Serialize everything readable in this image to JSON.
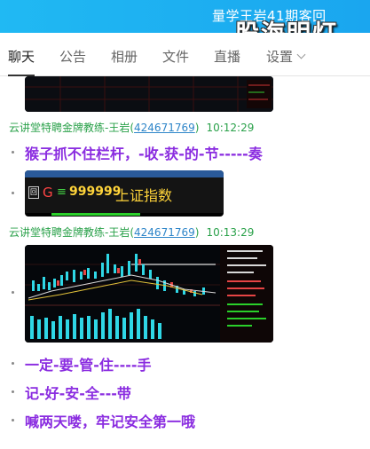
{
  "window": {
    "title": "量学王岩41期客回",
    "watermark": "股海明灯"
  },
  "tabs": [
    {
      "label": "聊天",
      "active": true
    },
    {
      "label": "公告"
    },
    {
      "label": "相册"
    },
    {
      "label": "文件"
    },
    {
      "label": "直播"
    },
    {
      "label": "设置"
    }
  ],
  "messages": {
    "m1": {
      "sender": "云讲堂特聘金牌教练-王岩",
      "qq": "424671769",
      "time": "10:12:29"
    },
    "m1_text": "猴子抓不住栏杆，-收-获-的-节-----奏",
    "quote": {
      "g": "G",
      "eq": "≡",
      "code": "999999",
      "name": "上证指数"
    },
    "m2": {
      "sender": "云讲堂特聘金牌教练-王岩",
      "qq": "424671769",
      "time": "10:13:29"
    },
    "lines": [
      "一定-要-管-住----手",
      "记-好-安-全---带",
      "喊两天喽，牢记安全第一哦"
    ]
  },
  "colors": {
    "titlebar": "#1aa6ef",
    "sender_green": "#2aa14a",
    "link_blue": "#2f86c9",
    "message_purple": "#8a2ce0"
  }
}
